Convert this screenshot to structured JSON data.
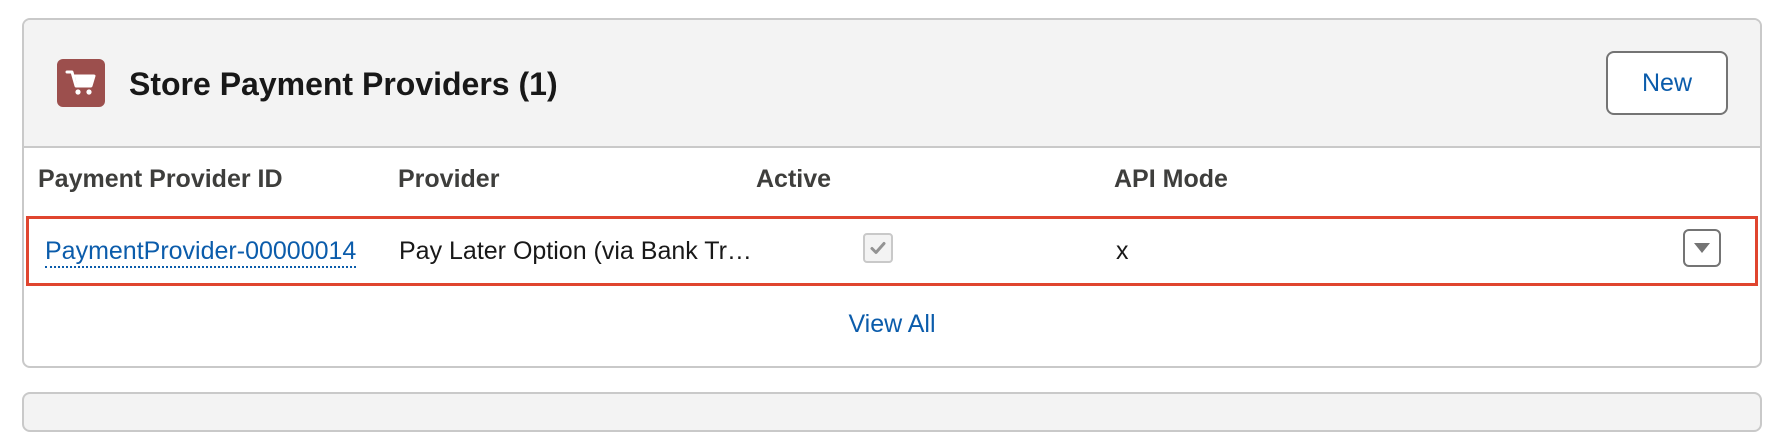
{
  "card": {
    "title": "Store Payment Providers (1)",
    "icon": "cart-icon",
    "icon_color": "#9c4f4d",
    "new_button_label": "New"
  },
  "table": {
    "columns": [
      "Payment Provider ID",
      "Provider",
      "Active",
      "API Mode"
    ],
    "rows": [
      {
        "payment_provider_id": "PaymentProvider-00000014",
        "provider": "Pay Later Option (via Bank Tr…",
        "active": true,
        "api_mode": "x"
      }
    ]
  },
  "footer": {
    "view_all_label": "View All"
  },
  "colors": {
    "link": "#0b5cab",
    "highlight_border": "#e0452f",
    "header_bg": "#f3f3f3"
  }
}
